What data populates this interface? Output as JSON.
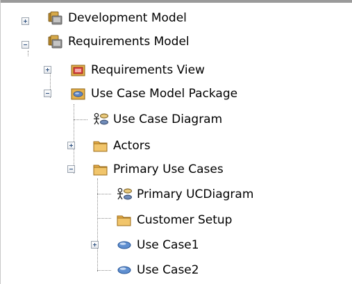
{
  "tree": {
    "nodes": [
      {
        "label": "Development Model",
        "icon": "model-package-icon",
        "expander": "plus"
      },
      {
        "label": "Requirements Model",
        "icon": "model-package-icon",
        "expander": "minus"
      },
      {
        "label": "Requirements View",
        "icon": "requirements-view-icon",
        "expander": "plus"
      },
      {
        "label": "Use Case Model Package",
        "icon": "use-case-view-icon",
        "expander": "minus"
      },
      {
        "label": "Use Case Diagram",
        "icon": "use-case-diagram-icon",
        "expander": "none"
      },
      {
        "label": "Actors",
        "icon": "folder-icon",
        "expander": "plus"
      },
      {
        "label": "Primary Use Cases",
        "icon": "folder-icon",
        "expander": "minus"
      },
      {
        "label": "Primary UCDiagram",
        "icon": "use-case-diagram-icon",
        "expander": "none"
      },
      {
        "label": "Customer Setup",
        "icon": "folder-icon",
        "expander": "none"
      },
      {
        "label": "Use Case1",
        "icon": "use-case-icon",
        "expander": "plus"
      },
      {
        "label": "Use Case2",
        "icon": "use-case-icon",
        "expander": "none"
      }
    ]
  }
}
